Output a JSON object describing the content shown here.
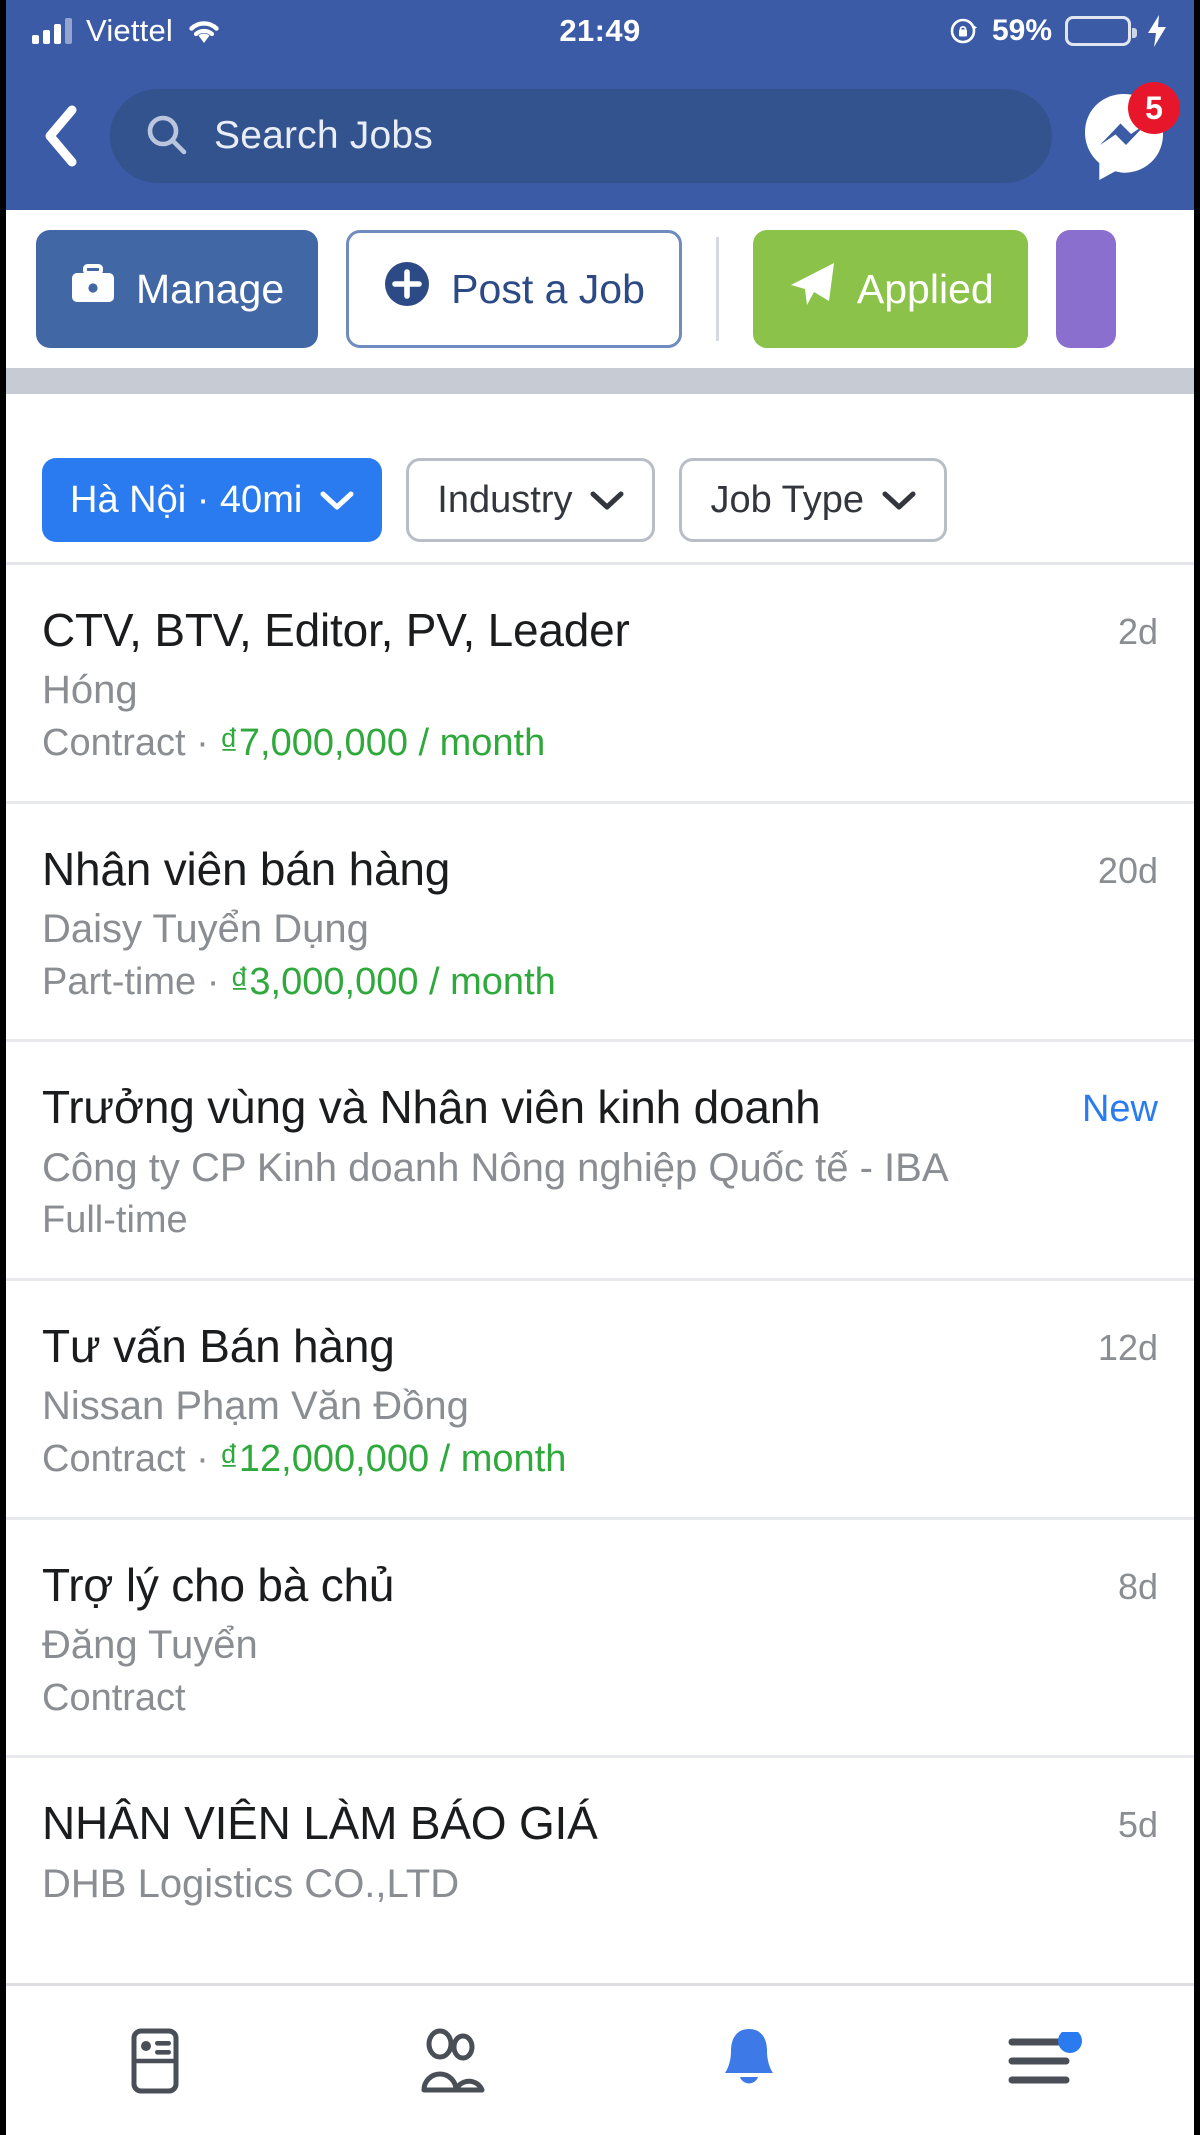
{
  "status_bar": {
    "carrier": "Viettel",
    "time": "21:49",
    "battery_percent": "59%",
    "icons": {
      "signal": "signal-bars-icon",
      "wifi": "wifi-icon",
      "rotation_lock": "rotation-lock-icon",
      "battery": "battery-icon",
      "charging": "charging-bolt-icon"
    }
  },
  "nav": {
    "back_icon": "back-chevron-icon",
    "search_placeholder": "Search Jobs",
    "search_icon": "search-icon",
    "messenger_icon": "messenger-icon",
    "messenger_badge": "5"
  },
  "actions": {
    "manage_label": "Manage",
    "manage_icon": "briefcase-icon",
    "post_label": "Post a Job",
    "post_icon": "plus-circle-icon",
    "applied_label": "Applied",
    "applied_icon": "paper-plane-icon"
  },
  "filters": [
    {
      "label": "Hà Nội · 40mi",
      "active": true
    },
    {
      "label": "Industry",
      "active": false
    },
    {
      "label": "Job Type",
      "active": false
    }
  ],
  "jobs": [
    {
      "title": "CTV, BTV, Editor, PV, Leader",
      "company": "Hóng",
      "type": "Contract",
      "salary": "₫7,000,000 / month",
      "time": "2d",
      "is_new": false
    },
    {
      "title": "Nhân viên bán hàng",
      "company": "Daisy Tuyển Dụng",
      "type": "Part-time",
      "salary": "₫3,000,000 / month",
      "time": "20d",
      "is_new": false
    },
    {
      "title": "Trưởng vùng và Nhân viên kinh doanh",
      "company": "Công ty CP Kinh doanh Nông nghiệp Quốc tế - IBA",
      "type": "Full-time",
      "salary": "",
      "time": "New",
      "is_new": true
    },
    {
      "title": "Tư vấn Bán hàng",
      "company": "Nissan Phạm Văn Đồng",
      "type": "Contract",
      "salary": "₫12,000,000 / month",
      "time": "12d",
      "is_new": false
    },
    {
      "title": "Trợ lý cho bà chủ",
      "company": "Đăng Tuyển",
      "type": "Contract",
      "salary": "",
      "time": "8d",
      "is_new": false
    },
    {
      "title": "NHÂN VIÊN LÀM BÁO GIÁ",
      "company": "DHB Logistics CO.,LTD",
      "type": "",
      "salary": "",
      "time": "5d",
      "is_new": false
    }
  ],
  "tabbar": [
    {
      "icon": "news-feed-icon",
      "active": false,
      "badge": false
    },
    {
      "icon": "friends-icon",
      "active": false,
      "badge": false
    },
    {
      "icon": "bell-icon",
      "active": true,
      "badge": false
    },
    {
      "icon": "menu-icon",
      "active": false,
      "badge": true
    }
  ],
  "colors": {
    "header_blue": "#3b5ba7",
    "accent_blue": "#2b7bf0",
    "salary_green": "#2fa83c",
    "applied_green": "#8bc34a",
    "badge_red": "#e8162a",
    "purple": "#8a6fce"
  }
}
